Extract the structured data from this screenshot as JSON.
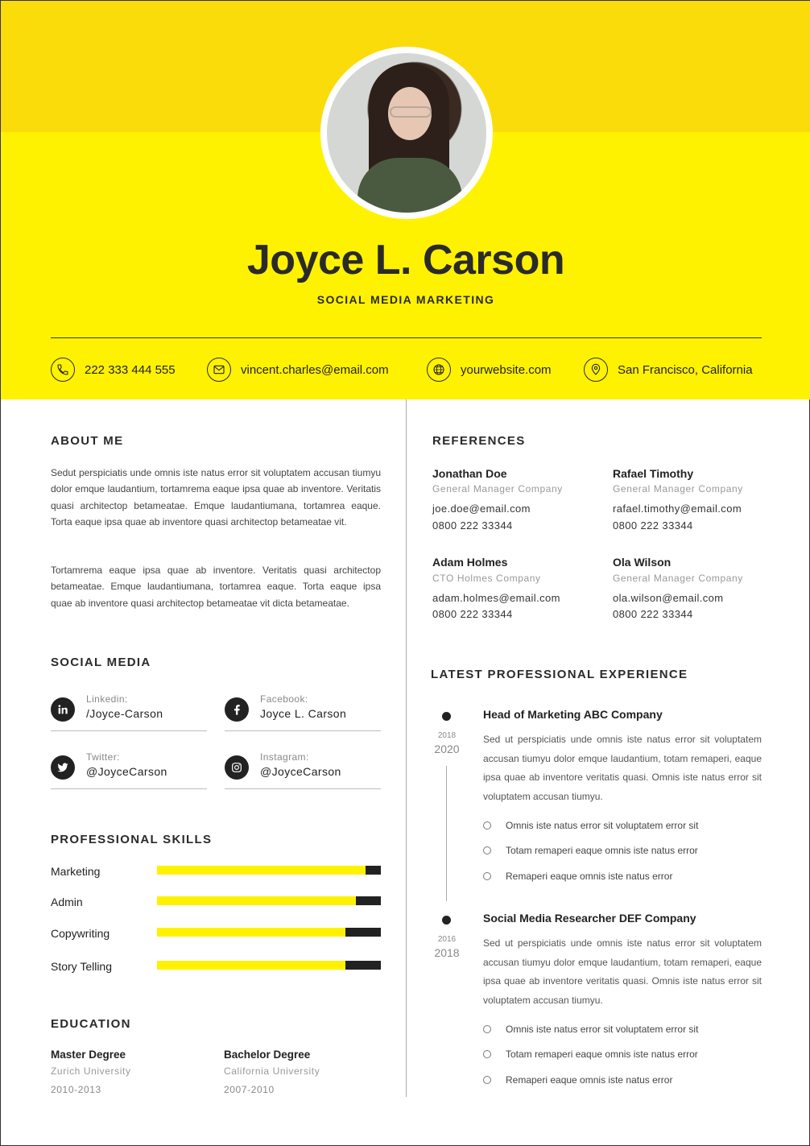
{
  "header": {
    "name": "Joyce L. Carson",
    "title": "SOCIAL MEDIA MARKETING",
    "contacts": [
      {
        "icon": "phone-icon",
        "text": "222 333 444 555"
      },
      {
        "icon": "mail-icon",
        "text": "vincent.charles@email.com"
      },
      {
        "icon": "globe-icon",
        "text": "yourwebsite.com"
      },
      {
        "icon": "location-icon",
        "text": "San Francisco, California"
      }
    ]
  },
  "about": {
    "heading": "ABOUT ME",
    "p1": "Sedut perspiciatis unde omnis iste natus error sit voluptatem accusan tiumyu dolor emque laudantium, tortamrema eaque ipsa quae ab inventore. Veritatis quasi architectop betameatae. Emque laudantiumana, tortamrea eaque. Torta eaque ipsa quae ab inventore quasi architectop betameatae vit.",
    "p2": "Tortamrema eaque ipsa quae ab inventore. Veritatis quasi architectop betameatae. Emque laudantiumana, tortamrea eaque. Torta eaque ipsa quae ab inventore quasi architectop betameatae vit dicta betameatae."
  },
  "social": {
    "heading": "SOCIAL MEDIA",
    "items": [
      {
        "icon": "linkedin-icon",
        "label": "Linkedin:",
        "value": "/Joyce-Carson"
      },
      {
        "icon": "facebook-icon",
        "label": "Facebook:",
        "value": "Joyce L. Carson"
      },
      {
        "icon": "twitter-icon",
        "label": "Twitter:",
        "value": "@JoyceCarson"
      },
      {
        "icon": "instagram-icon",
        "label": "Instagram:",
        "value": "@JoyceCarson"
      }
    ]
  },
  "skills": {
    "heading": "PROFESSIONAL SKILLS",
    "items": [
      {
        "label": "Marketing",
        "level": 0.93
      },
      {
        "label": "Admin",
        "level": 0.89
      },
      {
        "label": "Copywriting",
        "level": 0.84
      },
      {
        "label": "Story Telling",
        "level": 0.84
      }
    ]
  },
  "education": {
    "heading": "EDUCATION",
    "items": [
      {
        "degree": "Master Degree",
        "school": "Zurich University",
        "years": "2010-2013"
      },
      {
        "degree": "Bachelor Degree",
        "school": "California University",
        "years": "2007-2010"
      }
    ]
  },
  "references": {
    "heading": "REFERENCES",
    "items": [
      {
        "name": "Jonathan Doe",
        "role": "General Manager Company",
        "email": "joe.doe@email.com",
        "phone": "0800 222 33344"
      },
      {
        "name": "Rafael Timothy",
        "role": "General Manager Company",
        "email": "rafael.timothy@email.com",
        "phone": "0800 222 33344"
      },
      {
        "name": "Adam Holmes",
        "role": "CTO Holmes Company",
        "email": "adam.holmes@email.com",
        "phone": "0800 222 33344"
      },
      {
        "name": "Ola Wilson",
        "role": "General Manager Company",
        "email": "ola.wilson@email.com",
        "phone": "0800 222 33344"
      }
    ]
  },
  "experience": {
    "heading": "LATEST PROFESSIONAL EXPERIENCE",
    "jobs": [
      {
        "title": "Head of Marketing ABC Company",
        "year_start": "2018",
        "year_end": "2020",
        "description": "Sed ut perspiciatis unde omnis iste natus error sit voluptatem accusan tiumyu dolor emque laudantium, totam remaperi, eaque ipsa quae ab inventore veritatis quasi. Omnis iste natus error sit voluptatem accusan tiumyu.",
        "bullets": [
          "Omnis iste natus error sit voluptatem error sit",
          "Totam remaperi eaque omnis iste natus error",
          "Remaperi eaque omnis iste natus error"
        ]
      },
      {
        "title": "Social Media Researcher DEF Company",
        "year_start": "2016",
        "year_end": "2018",
        "description": "Sed ut perspiciatis unde omnis iste natus error sit voluptatem accusan tiumyu dolor emque laudantium, totam remaperi, eaque ipsa quae ab inventore veritatis quasi. Omnis iste natus error sit voluptatem accusan tiumyu.",
        "bullets": [
          "Omnis iste natus error sit voluptatem error sit",
          "Totam remaperi eaque omnis iste natus error",
          "Remaperi eaque omnis iste natus error"
        ]
      }
    ]
  },
  "colors": {
    "accent": "#fff200",
    "accent_dark": "#fbdc0b",
    "ink": "#222222"
  }
}
